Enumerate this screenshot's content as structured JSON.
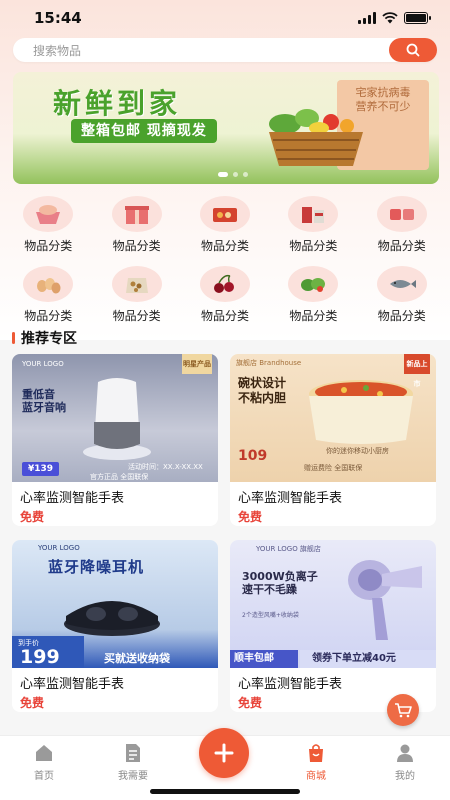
{
  "status": {
    "time": "15:44"
  },
  "search": {
    "placeholder": "搜索物品",
    "icon": "search-icon"
  },
  "banner": {
    "title": "新鲜到家",
    "subtitle": "整箱包邮 现摘现发",
    "side_line1": "宅家抗病毒",
    "side_line2": "营养不可少"
  },
  "categories": [
    {
      "label": "物品分类",
      "icon": "gift-basket-icon"
    },
    {
      "label": "物品分类",
      "icon": "gift-box-icon"
    },
    {
      "label": "物品分类",
      "icon": "snack-box-icon"
    },
    {
      "label": "物品分类",
      "icon": "gift-set-icon"
    },
    {
      "label": "物品分类",
      "icon": "meat-pack-icon"
    },
    {
      "label": "物品分类",
      "icon": "eggs-icon"
    },
    {
      "label": "物品分类",
      "icon": "nuts-bag-icon"
    },
    {
      "label": "物品分类",
      "icon": "cherries-icon"
    },
    {
      "label": "物品分类",
      "icon": "vegetables-icon"
    },
    {
      "label": "物品分类",
      "icon": "fish-icon"
    }
  ],
  "section": {
    "title": "推荐专区"
  },
  "products": [
    {
      "name": "心率监测智能手表",
      "price": "免费",
      "img_title": "重低音\n蓝牙音响",
      "img_price": "¥139",
      "img_footer": "官方正品 全国联保",
      "img_tag": "明星产品",
      "img_brand": "YOUR LOGO",
      "img_small": "活动时间：XX.X-XX.XX"
    },
    {
      "name": "心率监测智能手表",
      "price": "免费",
      "img_title": "碗状设计\n不粘内胆",
      "img_price": "109",
      "img_footer": "赠运费险 全国联保",
      "img_tag": "新品上市",
      "img_brand": "旗舰店 Brandhouse",
      "img_small": "你的迷你移动小厨房"
    },
    {
      "name": "心率监测智能手表",
      "price": "免费",
      "img_title": "蓝牙降噪耳机",
      "img_price": "199",
      "img_footer": "买就送收纳袋",
      "img_tag": "到手价",
      "img_brand": "YOUR LOGO",
      "img_small": ""
    },
    {
      "name": "心率监测智能手表",
      "price": "免费",
      "img_title": "3000W负离子\n速干不毛躁",
      "img_price": "顺丰包邮",
      "img_footer": "领券下单立减40元",
      "img_tag": "",
      "img_brand": "YOUR LOGO 旗舰店",
      "img_small": "2个造型风嘴+收纳袋"
    }
  ],
  "tabs": [
    {
      "label": "首页",
      "icon": "home-icon"
    },
    {
      "label": "我需要",
      "icon": "document-icon"
    },
    {
      "label": "",
      "icon": "plus-icon"
    },
    {
      "label": "商城",
      "icon": "shopping-bag-icon"
    },
    {
      "label": "我的",
      "icon": "profile-icon"
    }
  ],
  "colors": {
    "accent": "#ee5a36",
    "price": "#e8443a",
    "banner_green": "#4aa22c"
  }
}
